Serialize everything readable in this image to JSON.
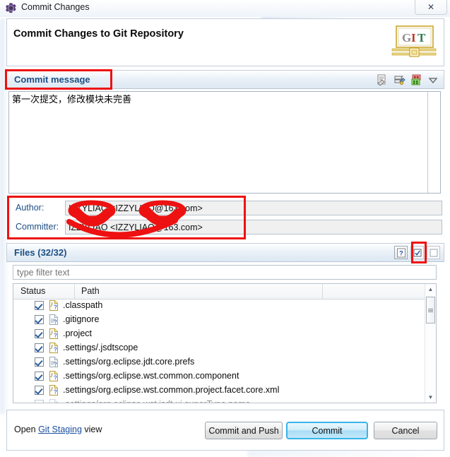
{
  "window": {
    "title": "Commit Changes",
    "title_icon": "gear-icon",
    "close_label": "✕"
  },
  "header": {
    "title": "Commit Changes to Git Repository",
    "logo_text": "GIT"
  },
  "commit_message": {
    "section_label": "Commit message",
    "value": "第一次提交，修改模块未完善",
    "toolbar": [
      {
        "name": "add-signed-off-by-icon",
        "label": "Add Signed-off-by"
      },
      {
        "name": "add-change-id-icon",
        "label": "Add Change-Id"
      },
      {
        "name": "amend-previous-commit-icon",
        "label": "Amend previous commit"
      },
      {
        "name": "chevron-down-icon",
        "label": "More"
      }
    ]
  },
  "identity": {
    "author_label": "Author:",
    "author_value": "IZZYLIAO <IZZYLIAO@163.com>",
    "committer_label": "Committer:",
    "committer_value": "IZZYLIAO <IZZYLIAO@163.com>"
  },
  "files": {
    "section_label": "Files (32/32)",
    "toolbar": [
      {
        "name": "help-icon",
        "label": "?"
      },
      {
        "name": "select-all-icon",
        "label": "Select all"
      },
      {
        "name": "deselect-all-icon",
        "label": "Deselect all"
      }
    ],
    "filter_placeholder": "type filter text",
    "filter_value": "",
    "columns": [
      "Status",
      "Path"
    ],
    "rows": [
      {
        "checked": true,
        "icon": "untracked-java-file-icon",
        "path": ".classpath"
      },
      {
        "checked": true,
        "icon": "untracked-file-icon",
        "path": ".gitignore"
      },
      {
        "checked": true,
        "icon": "untracked-java-file-icon",
        "path": ".project"
      },
      {
        "checked": true,
        "icon": "untracked-java-file-icon",
        "path": ".settings/.jsdtscope"
      },
      {
        "checked": true,
        "icon": "untracked-file-icon",
        "path": ".settings/org.eclipse.jdt.core.prefs"
      },
      {
        "checked": true,
        "icon": "untracked-java-file-icon",
        "path": ".settings/org.eclipse.wst.common.component"
      },
      {
        "checked": true,
        "icon": "untracked-java-file-icon",
        "path": ".settings/org.eclipse.wst.common.project.facet.core.xml"
      },
      {
        "checked": false,
        "icon": "untracked-file-icon",
        "path": ".settings/org.eclipse.wst.jsdt.ui.superType.name"
      }
    ],
    "scrollbar": {
      "up": "▲",
      "down": "▼"
    }
  },
  "footer": {
    "open_prefix": "Open ",
    "open_link": "Git Staging",
    "open_suffix": " view",
    "commit_and_push": "Commit and Push",
    "commit": "Commit",
    "cancel": "Cancel"
  },
  "colors": {
    "section_label": "#1c4f84",
    "annotation_red": "#ee1111",
    "default_button_accent": "#37b4e8",
    "link": "#1b4fa0"
  }
}
